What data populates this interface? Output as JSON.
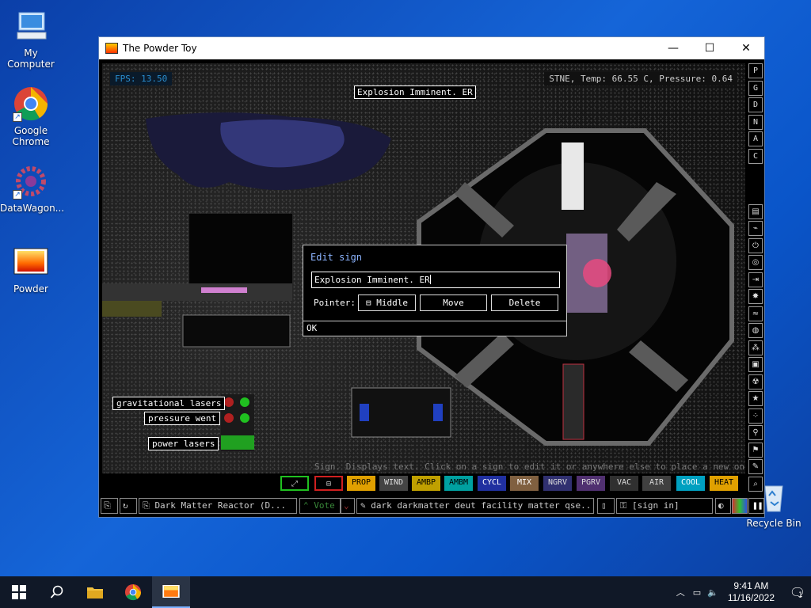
{
  "desktop": {
    "icons": [
      {
        "label": "My Computer",
        "icon": "computer-icon"
      },
      {
        "label": "Google Chrome",
        "icon": "chrome-icon"
      },
      {
        "label": "DataWagon...",
        "icon": "datawagon-icon"
      },
      {
        "label": "Powder",
        "icon": "powder-icon"
      },
      {
        "label": "Recycle Bin",
        "icon": "recycle-bin-icon"
      }
    ]
  },
  "window": {
    "title": "The Powder Toy",
    "minimize": "—",
    "maximize": "☐",
    "close": "✕"
  },
  "hud": {
    "fps": "FPS: 13.50",
    "info": "STNE, Temp: 66.55 C, Pressure: 0.64"
  },
  "sim": {
    "top_sign": "Explosion Imminent. ER",
    "signs": [
      "gravitational lasers",
      "pressure went",
      "power lasers"
    ],
    "status_line": "Sign. Displays text. Click on a sign to edit it or anywhere else to place a new one."
  },
  "dialog": {
    "title": "Edit sign",
    "text_value": "Explosion Imminent. ER",
    "pointer_label": "Pointer:",
    "pointer_value": "Middle",
    "move": "Move",
    "delete": "Delete",
    "ok": "OK"
  },
  "right_toolbar": {
    "top": [
      "P",
      "G",
      "D",
      "N",
      "A",
      "C"
    ],
    "tools": [
      "walls-icon",
      "electronics-icon",
      "power-icon",
      "sensors-icon",
      "force-icon",
      "explosives-icon",
      "gases-icon",
      "liquids-icon",
      "powders-icon",
      "solids-icon",
      "radioactive-icon",
      "special-icon",
      "life-icon",
      "tools-icon",
      "favorites-icon",
      "decoration-icon",
      "search-icon"
    ]
  },
  "menu": {
    "buttons": [
      {
        "label": "PROP",
        "color": "#e0a000"
      },
      {
        "label": "WIND",
        "color": "#444444"
      },
      {
        "label": "AMBP",
        "color": "#c0a000"
      },
      {
        "label": "AMBM",
        "color": "#00a0a0"
      },
      {
        "label": "CYCL",
        "color": "#2030a0"
      },
      {
        "label": "MIX",
        "color": "#806040"
      },
      {
        "label": "NGRV",
        "color": "#303070"
      },
      {
        "label": "PGRV",
        "color": "#503070"
      },
      {
        "label": "VAC",
        "color": "#303030"
      },
      {
        "label": "AIR",
        "color": "#404040"
      },
      {
        "label": "COOL",
        "color": "#00a0c0"
      },
      {
        "label": "HEAT",
        "color": "#e0a000"
      }
    ]
  },
  "bottom": {
    "save_name": "Dark Matter Reactor (D...",
    "vote": "Vote",
    "tags": "dark darkmatter deut facility matter qse...",
    "sign_in": "[sign in]"
  },
  "taskbar": {
    "time": "9:41 AM",
    "date": "11/16/2022",
    "notifications": "1"
  }
}
